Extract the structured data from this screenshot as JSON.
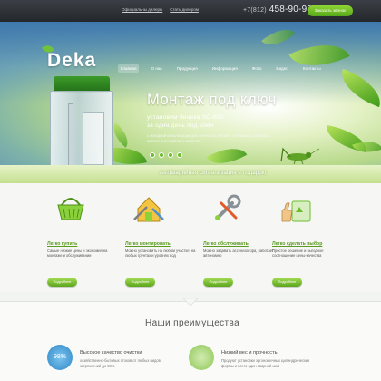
{
  "topbar": {
    "links": [
      "Официальны дилеры",
      "Стать дилером"
    ],
    "phone_code": "+7(812)",
    "phone_number": "458-90-98",
    "callback_label": "Заказать звонок"
  },
  "logo": {
    "text": "Deka"
  },
  "nav": {
    "items": [
      "Главная",
      "О нас",
      "Продукция",
      "Информация",
      "Фото",
      "Видео",
      "Контакты"
    ]
  },
  "hero": {
    "title": "Монтаж под ключ",
    "subtitle_line1": "установим биоека SC-800",
    "subtitle_line2": "за один день под ключ",
    "description": "с оскодной канализации для легочного обезвес, рекламных вставок и железо высочайшего качества",
    "slides_count": 4
  },
  "banner": {
    "text": "Антиварийная сигнализация в подарок!"
  },
  "features": [
    {
      "title": "Легко купить",
      "desc": "Самые низкие цены и экономия на монтаже и обслуживании",
      "button": "Подробнее",
      "icon": "basket-icon"
    },
    {
      "title": "Легко монтировать",
      "desc": "Можно установить на любом участке, на любых грунтах и уровнях вод",
      "button": "Подробнее",
      "icon": "house-tools-icon"
    },
    {
      "title": "Легко обслуживать",
      "desc": "Можно задавать ассенизатора, работает автономно",
      "button": "Подробнее",
      "icon": "wrench-icon"
    },
    {
      "title": "Легко сделать выбор",
      "desc": "Простое решение и выгодное соотношение цены-качества",
      "button": "Подробнее",
      "icon": "thumbs-up-box-icon"
    }
  ],
  "advantages": {
    "title": "Наши преимущества",
    "items": [
      {
        "badge": "98%",
        "head": "Высокое качество очистки",
        "text": "хозяйственно-бытовых стоков от любых видов загрязнений до 98%"
      },
      {
        "badge": "",
        "head": "Низкий вес и прочность",
        "text": "Продуют установки эргономичных цилиндрических формы и всего один сварной шов"
      }
    ]
  },
  "colors": {
    "accent": "#6cbd2e",
    "topbar": "#2c2f33",
    "sky": "#3f79ad"
  }
}
